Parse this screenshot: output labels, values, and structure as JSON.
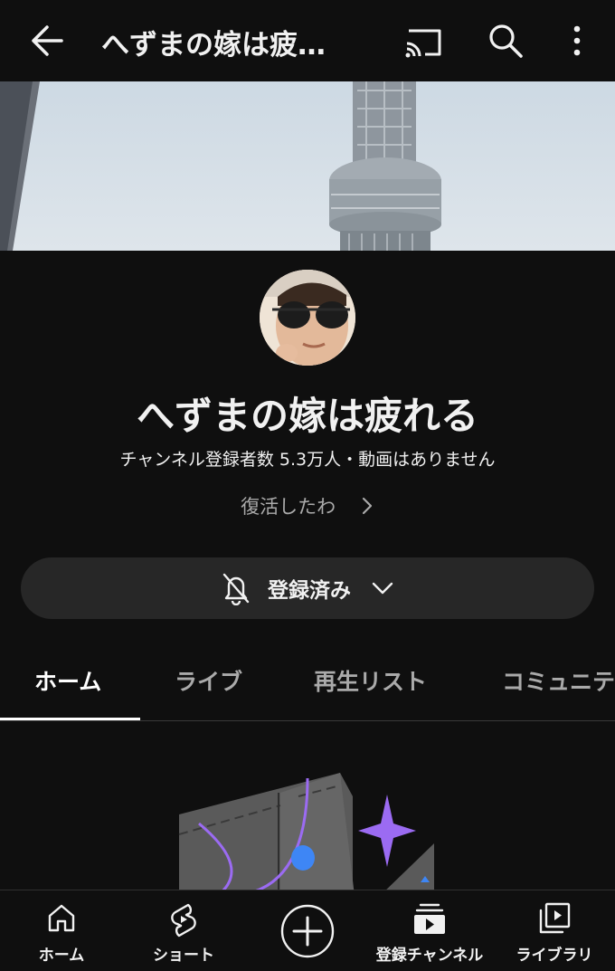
{
  "header": {
    "title": "へずまの嫁は疲…",
    "back_icon": "arrow-left-icon",
    "cast_icon": "cast-icon",
    "search_icon": "search-icon",
    "more_icon": "more-vertical-icon"
  },
  "channel": {
    "name": "へずまの嫁は疲れる",
    "meta": "チャンネル登録者数 5.3万人・動画はありません",
    "description": "復活したわ"
  },
  "subscribe": {
    "label": "登録済み",
    "bell_icon": "bell-off-icon",
    "chevron_icon": "chevron-down-icon"
  },
  "tabs": [
    {
      "label": "ホーム",
      "active": true
    },
    {
      "label": "ライブ",
      "active": false
    },
    {
      "label": "再生リスト",
      "active": false
    },
    {
      "label": "コミュニテ",
      "active": false
    }
  ],
  "bottom_nav": [
    {
      "label": "ホーム",
      "icon": "home-icon"
    },
    {
      "label": "ショート",
      "icon": "shorts-icon"
    },
    {
      "label": "",
      "icon": "create-plus-icon"
    },
    {
      "label": "登録チャンネル",
      "icon": "subscriptions-icon"
    },
    {
      "label": "ライブラリ",
      "icon": "library-icon"
    }
  ],
  "colors": {
    "background": "#0f0f0f",
    "button_bg": "#272727",
    "muted_text": "#aaaaaa",
    "accent_purple": "#9b6bf2",
    "accent_blue": "#3e86f5"
  }
}
